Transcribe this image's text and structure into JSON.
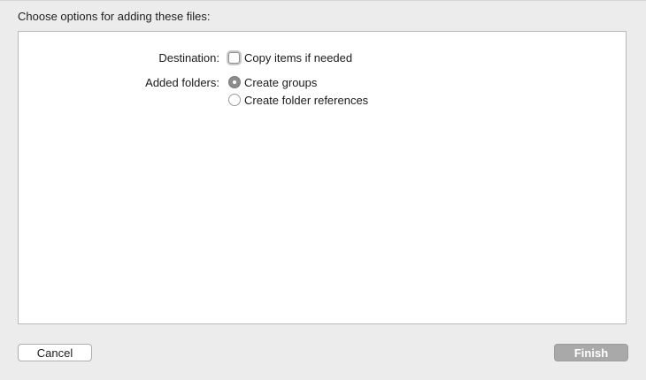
{
  "dialog": {
    "title": "Choose options for adding these files:"
  },
  "options": {
    "destination": {
      "label": "Destination:",
      "checkbox_label": "Copy items if needed",
      "checked": false
    },
    "added_folders": {
      "label": "Added folders:",
      "choices": [
        {
          "label": "Create groups",
          "selected": true
        },
        {
          "label": "Create folder references",
          "selected": false
        }
      ]
    }
  },
  "buttons": {
    "cancel_label": "Cancel",
    "finish_label": "Finish"
  },
  "colors": {
    "background": "#ececec",
    "panel": "#ffffff",
    "finish_disabled": "#a9a9a9"
  }
}
